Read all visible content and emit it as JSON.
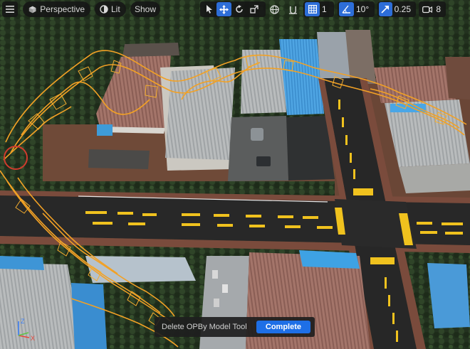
{
  "toolbar": {
    "view_mode": "Perspective",
    "lighting": "Lit",
    "show": "Show",
    "grid_snap_value": "1",
    "rotation_snap_value": "10°",
    "scale_snap_value": "0.25",
    "camera_speed_value": "8"
  },
  "tool_panel": {
    "tool_name": "Delete OPBy Model Tool",
    "complete_label": "Complete"
  },
  "axis_gizmo": {
    "z_label": "Z",
    "x_label": "X"
  },
  "colors": {
    "accent": "#2d6ed8",
    "complete_button": "#1e6fe6",
    "outline_orange": "#f2a125",
    "road_marking_yellow": "#f0c21e",
    "axis_x": "#e8463a",
    "axis_z": "#3d7ff2",
    "axis_y": "#5dc346"
  },
  "icons": {
    "menu": "hamburger-icon",
    "perspective": "cube-icon",
    "lit": "sun-icon",
    "select": "cursor-icon",
    "translate": "move-arrows-icon",
    "rotate": "rotate-icon",
    "scale": "scale-icon",
    "world_space": "globe-icon",
    "surface_snap": "snap-icon",
    "grid_snap": "grid-icon",
    "rotation_snap": "angle-icon",
    "scale_snap": "scale-arrow-icon",
    "camera_speed": "camera-icon"
  }
}
